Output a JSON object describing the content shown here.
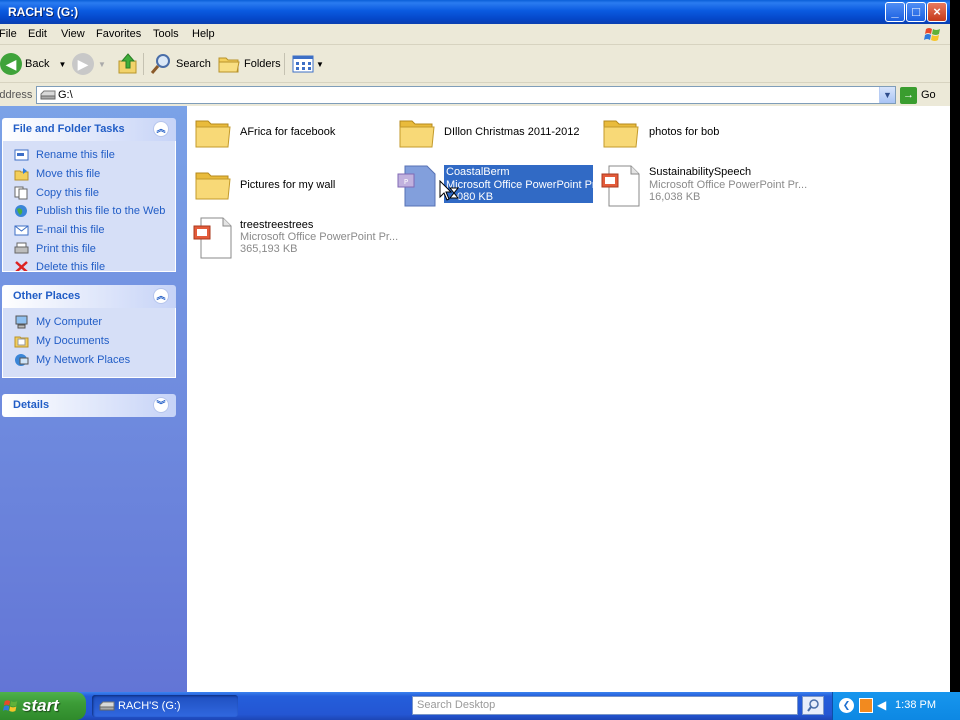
{
  "window": {
    "title": "RACH'S (G:)",
    "buttons": {
      "minimize": "_",
      "maximize": "□",
      "close": "×"
    }
  },
  "menu": [
    "File",
    "Edit",
    "View",
    "Favorites",
    "Tools",
    "Help"
  ],
  "toolbar": {
    "back": "Back",
    "search": "Search",
    "folders": "Folders"
  },
  "address": {
    "label": "Address",
    "value": "G:\\",
    "go": "Go"
  },
  "left_pane": {
    "file_tasks": {
      "title": "File and Folder Tasks",
      "items": [
        "Rename this file",
        "Move this file",
        "Copy this file",
        "Publish this file to the Web",
        "E-mail this file",
        "Print this file",
        "Delete this file"
      ]
    },
    "other_places": {
      "title": "Other Places",
      "items": [
        "My Computer",
        "My Documents",
        "My Network Places"
      ]
    },
    "details": {
      "title": "Details"
    }
  },
  "files": [
    {
      "name": "AFrica for facebook",
      "kind": "folder"
    },
    {
      "name": "DIllon Christmas 2011-2012",
      "kind": "folder"
    },
    {
      "name": "photos for bob",
      "kind": "folder"
    },
    {
      "name": "Pictures for my wall",
      "kind": "folder"
    },
    {
      "name": "CoastalBerm",
      "kind": "ppt",
      "type": "Microsoft Office PowerPoint Pr...",
      "size": "080 KB",
      "selected": true
    },
    {
      "name": "SustainabilitySpeech",
      "kind": "ppt",
      "type": "Microsoft Office PowerPoint Pr...",
      "size": "16,038 KB"
    },
    {
      "name": "treestreestrees",
      "kind": "ppt",
      "type": "Microsoft Office PowerPoint Pr...",
      "size": "365,193 KB"
    }
  ],
  "taskbar": {
    "start": "start",
    "task_button": "RACH'S (G:)",
    "search_placeholder": "Search Desktop",
    "clock": "1:38 PM"
  },
  "colors": {
    "title_blue": "#0a5ae0",
    "link_blue": "#215dc6",
    "selection": "#316ac5",
    "start_green": "#3c9c37"
  }
}
